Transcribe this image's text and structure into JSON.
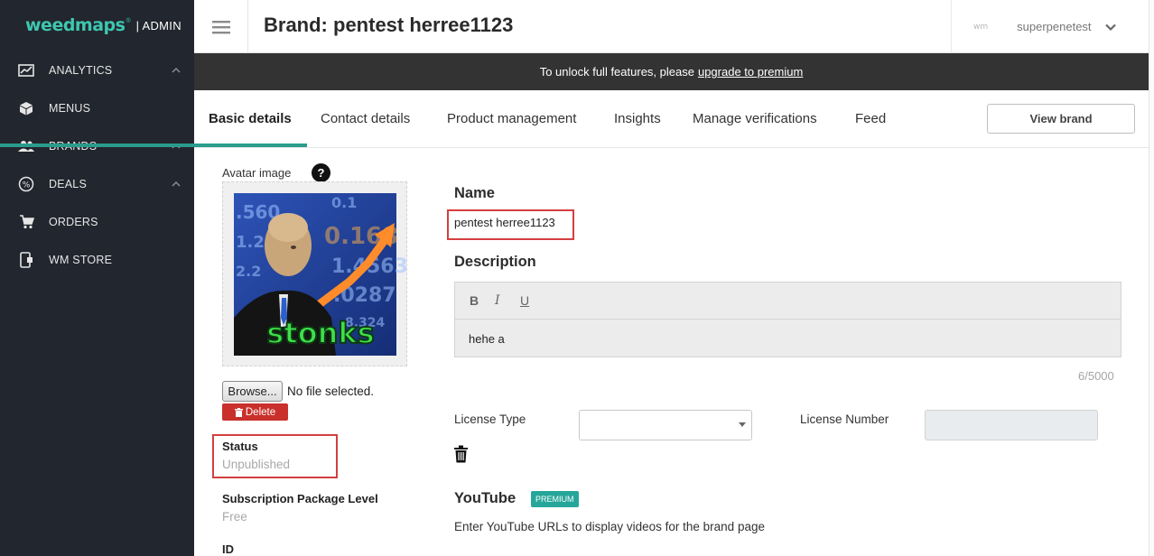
{
  "brand": {
    "logo_word": "weedmaps",
    "logo_tm": "®",
    "admin_label": "| ADMIN",
    "accent_color": "#3ec7b0"
  },
  "sidebar": {
    "items": [
      {
        "label": "ANALYTICS",
        "icon": "analytics-chart-icon",
        "expandable": true
      },
      {
        "label": "MENUS",
        "icon": "box-icon",
        "expandable": false
      },
      {
        "label": "BRANDS",
        "icon": "people-icon",
        "expandable": true
      },
      {
        "label": "DEALS",
        "icon": "percent-icon",
        "expandable": true
      },
      {
        "label": "ORDERS",
        "icon": "cart-icon",
        "expandable": false
      },
      {
        "label": "WM STORE",
        "icon": "mobile-store-icon",
        "expandable": false
      }
    ]
  },
  "header": {
    "title": "Brand: pentest herree1123",
    "wm_mini": "wm",
    "username": "superpenetest"
  },
  "banner": {
    "text": "To unlock full features, please",
    "link": "upgrade to premium"
  },
  "tabs": [
    {
      "label": "Basic details",
      "active": true
    },
    {
      "label": "Contact details",
      "active": false
    },
    {
      "label": "Product management",
      "active": false
    },
    {
      "label": "Insights",
      "active": false
    },
    {
      "label": "Manage verifications",
      "active": false
    },
    {
      "label": "Feed",
      "active": false
    }
  ],
  "view_brand_label": "View brand",
  "left_panel": {
    "avatar_label": "Avatar image",
    "help_glyph": "?",
    "avatar_caption": "stonks",
    "browse_label": "Browse...",
    "file_status": "No file selected.",
    "delete_label": "Delete",
    "status_label": "Status",
    "status_value": "Unpublished",
    "subscription_label": "Subscription Package Level",
    "subscription_value": "Free",
    "id_label": "ID"
  },
  "form": {
    "name_heading": "Name",
    "name_value": "pentest herree1123",
    "description_heading": "Description",
    "format_buttons": [
      "B",
      "I",
      "U"
    ],
    "description_value": "hehe a",
    "char_count": "6/5000",
    "license_type_label": "License Type",
    "license_type_value": "",
    "license_number_label": "License Number",
    "license_number_value": "",
    "youtube_heading": "YouTube",
    "premium_badge": "PREMIUM",
    "youtube_help": "Enter YouTube URLs to display videos for the brand page"
  },
  "colors": {
    "sidebar_bg": "#22262e",
    "banner_bg": "#333333",
    "tab_underline": "#2a9c8d",
    "highlight_box": "#d43f3f",
    "delete_button": "#c9302c",
    "premium_badge": "#26a69a"
  }
}
